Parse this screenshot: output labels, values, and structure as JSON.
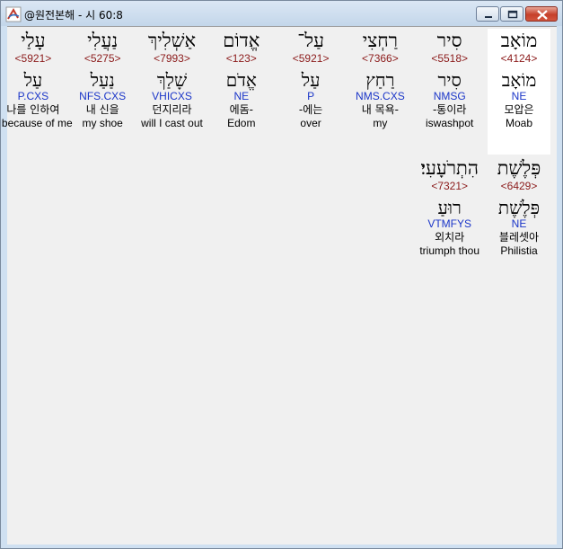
{
  "window": {
    "title": "@원전본해 - 시 60:8"
  },
  "rows": [
    [
      {
        "heb": "מוֹאָב",
        "strong": "<4124>",
        "lex": "מוֹאָב",
        "morph": "NE",
        "ko": "모압은",
        "en": "Moab",
        "selected": true
      },
      {
        "heb": "סִיר",
        "strong": "<5518>",
        "lex": "סִיר",
        "morph": "NMSG",
        "ko": "-통이라",
        "en": "iswashpot"
      },
      {
        "heb": "רַחְצִי",
        "strong": "<7366>",
        "lex": "רַחַץ",
        "morph": "NMS.CXS",
        "ko": "내 목욕-",
        "en": "my"
      },
      {
        "heb": "עַל־",
        "strong": "<5921>",
        "lex": "עַל",
        "morph": "P",
        "ko": "-에는",
        "en": "over"
      },
      {
        "heb": "אֱדוֹם",
        "strong": "<123>",
        "lex": "אֱדֹם",
        "morph": "NE",
        "ko": "에돔-",
        "en": "Edom"
      },
      {
        "heb": "אַשְׁלִיךְ",
        "strong": "<7993>",
        "lex": "שָׁלַךְ",
        "morph": "VHICXS",
        "ko": "던지리라",
        "en": "will I cast out"
      },
      {
        "heb": "נַעֲלִי",
        "strong": "<5275>",
        "lex": "נַעַל",
        "morph": "NFS.CXS",
        "ko": "내 신을",
        "en": "my shoe"
      },
      {
        "heb": "עָלַי",
        "strong": "<5921>",
        "lex": "עַל",
        "morph": "P.CXS",
        "ko": "나를 인하여",
        "en": "because of me"
      }
    ],
    [
      {
        "heb": "פְּלֶשֶׁת",
        "strong": "<6429>",
        "lex": "פְּלֶשֶׁת",
        "morph": "NE",
        "ko": "블레셋아",
        "en": "Philistia"
      },
      {
        "heb": "הִתְרֹעָעִי׃",
        "strong": "<7321>",
        "lex": "רוּעַ",
        "morph": "VTMFYS",
        "ko": "외치라",
        "en": "triumph thou"
      }
    ]
  ]
}
